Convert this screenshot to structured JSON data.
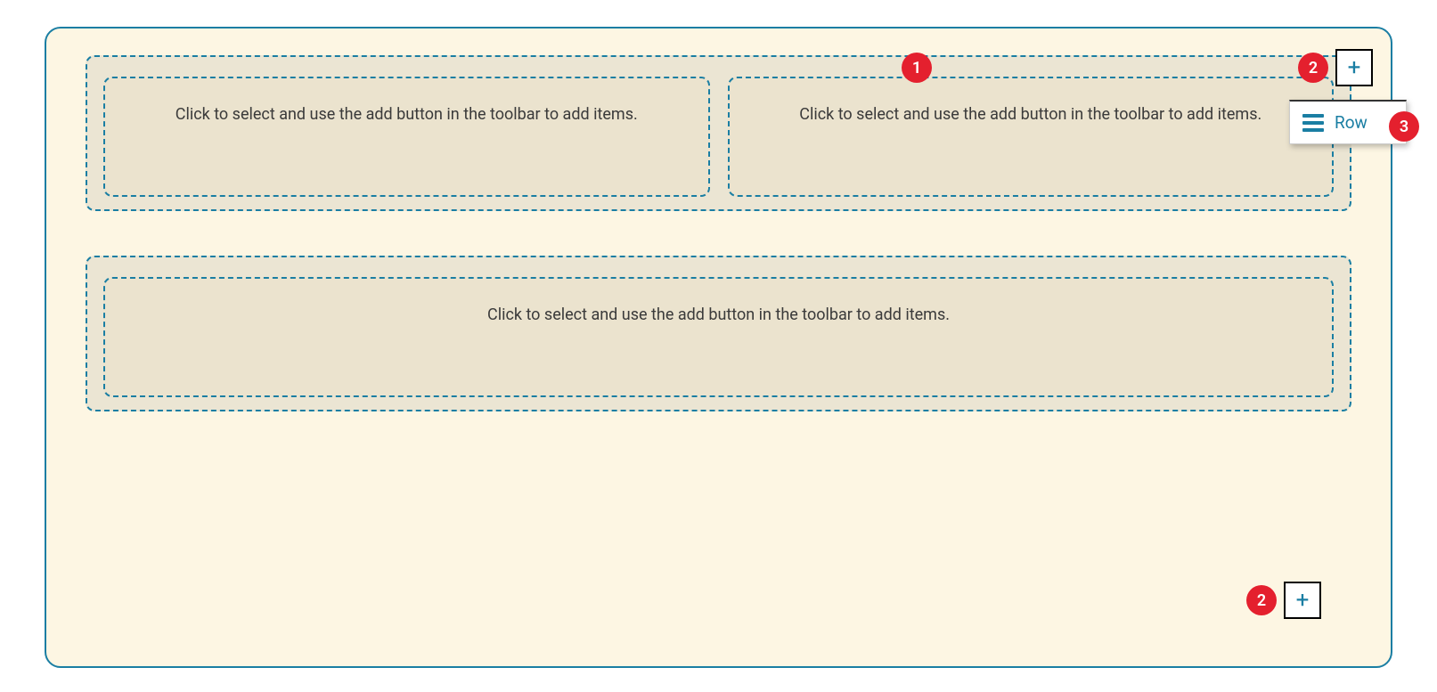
{
  "badges": {
    "b1": "1",
    "b2": "2",
    "b3": "3"
  },
  "placeholders": {
    "cell_text": "Click to select and use the add button in the toolbar to add items."
  },
  "dropdown": {
    "row_label": "Row"
  },
  "rows": [
    {
      "cols": 2
    },
    {
      "cols": 1
    }
  ]
}
